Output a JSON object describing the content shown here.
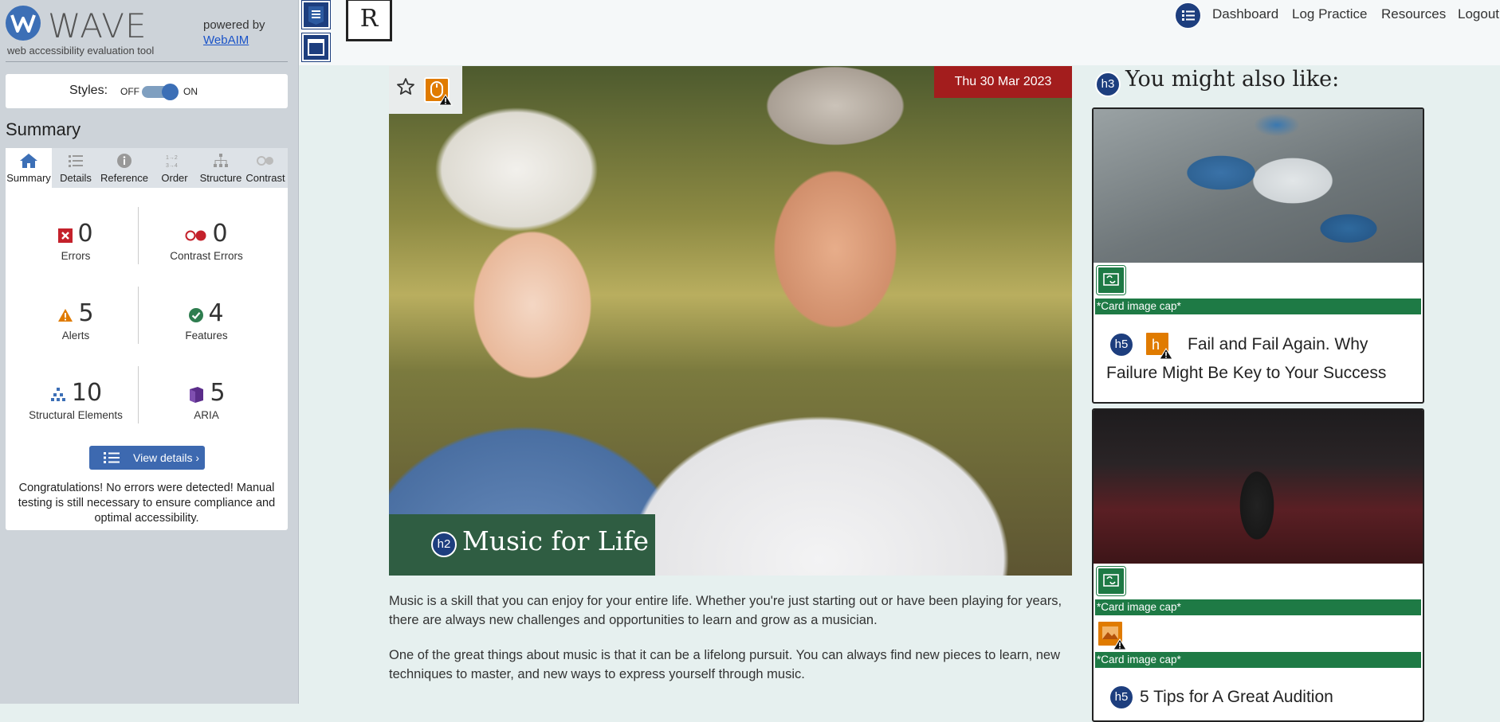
{
  "wave": {
    "title": "WAVE",
    "subtitle": "web accessibility evaluation tool",
    "powered_by": "powered by",
    "webaim_link": "WebAIM",
    "styles_label": "Styles:",
    "styles_off": "OFF",
    "styles_on": "ON",
    "styles_enabled": true,
    "summary_heading": "Summary",
    "tabs": [
      {
        "label": "Summary",
        "icon": "home-icon",
        "active": true
      },
      {
        "label": "Details",
        "icon": "list-icon",
        "active": false
      },
      {
        "label": "Reference",
        "icon": "info-icon",
        "active": false
      },
      {
        "label": "Order",
        "icon": "order-icon",
        "active": false
      },
      {
        "label": "Structure",
        "icon": "structure-icon",
        "active": false
      },
      {
        "label": "Contrast",
        "icon": "contrast-icon",
        "active": false
      }
    ],
    "stats": {
      "errors": {
        "count": "0",
        "label": "Errors"
      },
      "contrast_errors": {
        "count": "0",
        "label": "Contrast Errors"
      },
      "alerts": {
        "count": "5",
        "label": "Alerts"
      },
      "features": {
        "count": "4",
        "label": "Features"
      },
      "structural": {
        "count": "10",
        "label": "Structural Elements"
      },
      "aria": {
        "count": "5",
        "label": "ARIA"
      }
    },
    "view_details": "View details ›",
    "congrats": "Congratulations! No errors were detected! Manual testing is still necessary to ensure compliance and optimal accessibility.",
    "colors": {
      "accent": "#3c6fb6",
      "error": "#c4212b",
      "alert": "#e07b00",
      "feature": "#2e7d4f",
      "aria": "#5b2d8a"
    }
  },
  "site": {
    "logo": "R",
    "nav": [
      "Dashboard",
      "Log Practice",
      "Resources",
      "Logout"
    ],
    "hero": {
      "date": "Thu 30 Mar 2023",
      "heading_level": "h2",
      "title": "Music for Life"
    },
    "paragraphs": [
      "Music is a skill that you can enjoy for your entire life. Whether you're just starting out or have been playing for years, there are always new challenges and opportunities to learn and grow as a musician.",
      "One of the great things about music is that it can be a lifelong pursuit. You can always find new pieces to learn, new techniques to master, and new ways to express yourself through music."
    ],
    "sidebar": {
      "heading_level": "h3",
      "heading": "You might also like:",
      "cards": [
        {
          "caption": "*Card image cap*",
          "heading_level": "h5",
          "title": "Fail and Fail Again. Why Failure Might Be Key to Your Success"
        },
        {
          "caption": "*Card image cap*",
          "caption2": "*Card image cap*",
          "heading_level": "h5",
          "title": "5 Tips for A Great Audition"
        }
      ]
    }
  }
}
